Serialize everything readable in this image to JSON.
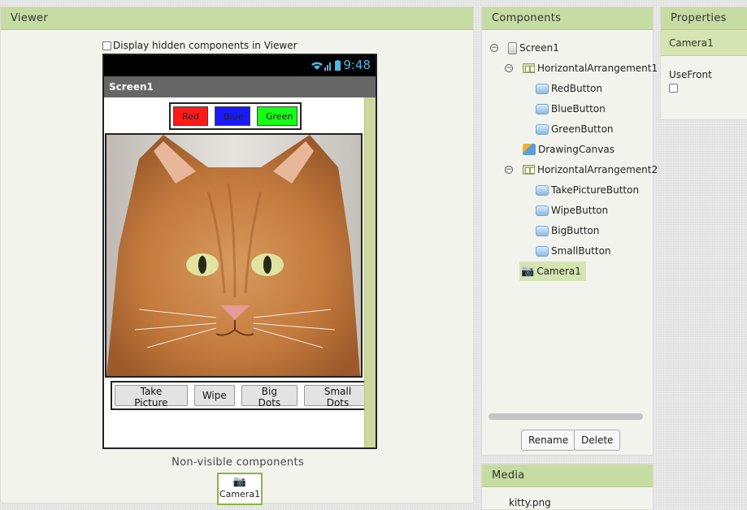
{
  "viewer": {
    "title": "Viewer",
    "display_hidden_label": "Display hidden components in Viewer",
    "phone": {
      "clock": "9:48",
      "screen_title": "Screen1",
      "color_buttons": [
        "Red",
        "Blue",
        "Green"
      ],
      "action_buttons": [
        "Take Picture",
        "Wipe",
        "Big Dots",
        "Small Dots"
      ]
    },
    "nonvisible_label": "Non-visible components",
    "nonvisible_items": [
      "Camera1"
    ]
  },
  "components": {
    "title": "Components",
    "tree": [
      {
        "label": "Screen1",
        "icon": "screen-icon"
      },
      {
        "label": "HorizontalArrangement1",
        "icon": "horizontal-arrangement-icon"
      },
      {
        "label": "RedButton",
        "icon": "button-icon"
      },
      {
        "label": "BlueButton",
        "icon": "button-icon"
      },
      {
        "label": "GreenButton",
        "icon": "button-icon"
      },
      {
        "label": "DrawingCanvas",
        "icon": "canvas-icon"
      },
      {
        "label": "HorizontalArrangement2",
        "icon": "horizontal-arrangement-icon"
      },
      {
        "label": "TakePictureButton",
        "icon": "button-icon"
      },
      {
        "label": "WipeButton",
        "icon": "button-icon"
      },
      {
        "label": "BigButton",
        "icon": "button-icon"
      },
      {
        "label": "SmallButton",
        "icon": "button-icon"
      },
      {
        "label": "Camera1",
        "icon": "camera-icon"
      }
    ],
    "selected": "Camera1",
    "rename_label": "Rename",
    "delete_label": "Delete"
  },
  "media": {
    "title": "Media",
    "files": [
      "kitty.png"
    ]
  },
  "properties": {
    "title": "Properties",
    "component": "Camera1",
    "use_front_label": "UseFront",
    "use_front_checked": false
  }
}
